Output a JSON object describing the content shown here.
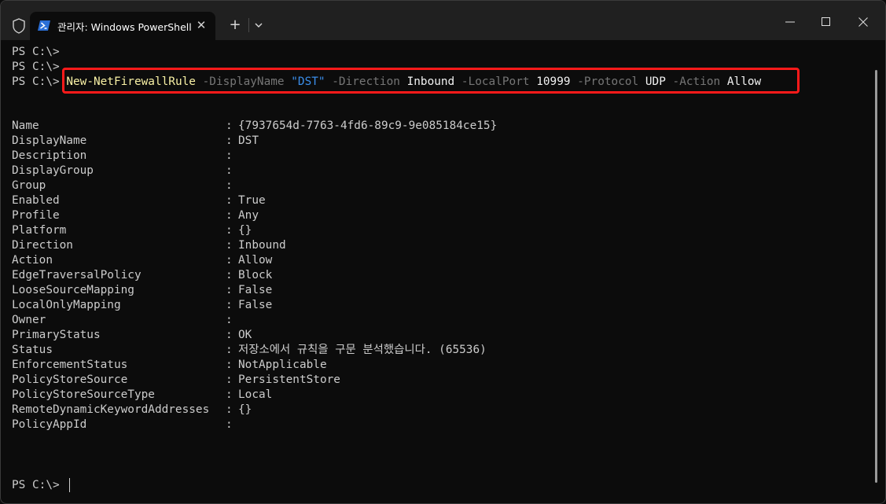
{
  "window": {
    "tab_title": "관리자: Windows PowerShell",
    "tab_close": "✕",
    "new_tab": "+",
    "icons": [
      "shield-icon",
      "powershell-icon",
      "close-icon",
      "plus-icon",
      "chevron-down-icon",
      "minimize-icon",
      "maximize-icon",
      "close-window-icon"
    ]
  },
  "terminal": {
    "prompt": "PS C:\\>",
    "command": {
      "cmdlet": "New-NetFirewallRule",
      "p1": "-DisplayName",
      "v1": "\"DST\"",
      "p2": "-Direction",
      "v2": "Inbound",
      "p3": "-LocalPort",
      "v3": "10999",
      "p4": "-Protocol",
      "v4": "UDP",
      "p5": "-Action",
      "v5": "Allow"
    },
    "separator": ":",
    "properties": [
      {
        "name": "Name",
        "value": "{7937654d-7763-4fd6-89c9-9e085184ce15}"
      },
      {
        "name": "DisplayName",
        "value": "DST"
      },
      {
        "name": "Description",
        "value": ""
      },
      {
        "name": "DisplayGroup",
        "value": ""
      },
      {
        "name": "Group",
        "value": ""
      },
      {
        "name": "Enabled",
        "value": "True"
      },
      {
        "name": "Profile",
        "value": "Any"
      },
      {
        "name": "Platform",
        "value": "{}"
      },
      {
        "name": "Direction",
        "value": "Inbound"
      },
      {
        "name": "Action",
        "value": "Allow"
      },
      {
        "name": "EdgeTraversalPolicy",
        "value": "Block"
      },
      {
        "name": "LooseSourceMapping",
        "value": "False"
      },
      {
        "name": "LocalOnlyMapping",
        "value": "False"
      },
      {
        "name": "Owner",
        "value": ""
      },
      {
        "name": "PrimaryStatus",
        "value": "OK"
      },
      {
        "name": "Status",
        "value": "저장소에서 규칙을 구문 분석했습니다. (65536)"
      },
      {
        "name": "EnforcementStatus",
        "value": "NotApplicable"
      },
      {
        "name": "PolicyStoreSource",
        "value": "PersistentStore"
      },
      {
        "name": "PolicyStoreSourceType",
        "value": "Local"
      },
      {
        "name": "RemoteDynamicKeywordAddresses",
        "value": "{}"
      },
      {
        "name": "PolicyAppId",
        "value": ""
      }
    ]
  },
  "colors": {
    "background": "#0c0c0c",
    "titlebar": "#202020",
    "cmdlet": "#f9f1a5",
    "parameter": "#767676",
    "string": "#3b8eea",
    "highlight_border": "#ff1a1a"
  }
}
